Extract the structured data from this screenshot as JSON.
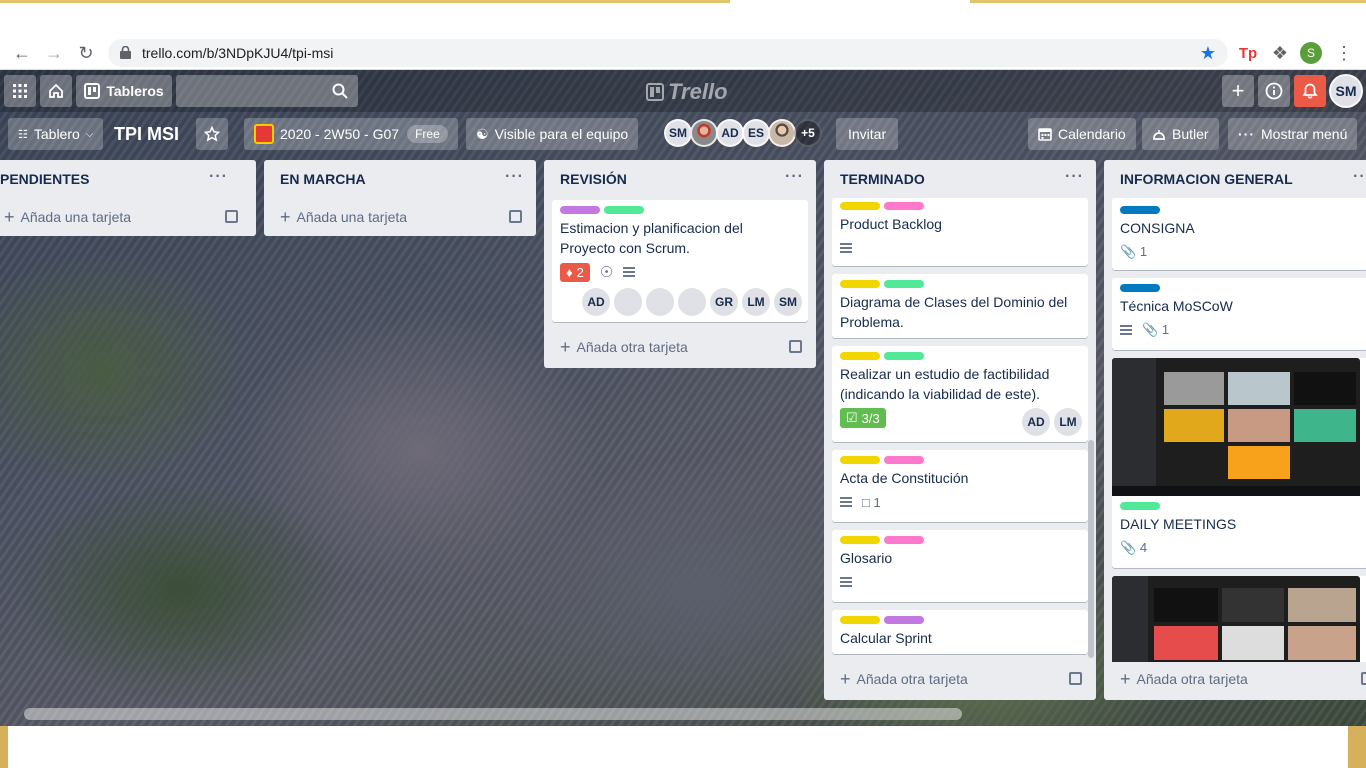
{
  "browser": {
    "url": "trello.com/b/3NDpKJU4/tpi-msi",
    "profile_initial": "S"
  },
  "header": {
    "boards_label": "Tableros",
    "logo_text": "Trello",
    "user_initials": "SM"
  },
  "boardbar": {
    "view_label": "Tablero",
    "board_name": "TPI MSI",
    "team_name": "2020 - 2W50 - G07",
    "team_plan": "Free",
    "visibility_label": "Visible para el equipo",
    "members": [
      "SM",
      "AD",
      "ES"
    ],
    "more_members": "+5",
    "invite_label": "Invitar",
    "calendar_label": "Calendario",
    "butler_label": "Butler",
    "menu_label": "Mostrar menú"
  },
  "lists": [
    {
      "title": "PENDIENTES",
      "add_label": "Añada una tarjeta"
    },
    {
      "title": "EN MARCHA",
      "add_label": "Añada una tarjeta"
    },
    {
      "title": "REVISIÓN",
      "add_label": "Añada otra tarjeta",
      "cards": [
        {
          "title": "Estimacion y planificacion del Proyecto con Scrum.",
          "notifications": "2",
          "members": [
            "AD",
            "GR",
            "LM",
            "SM"
          ]
        }
      ]
    },
    {
      "title": "TERMINADO",
      "add_label": "Añada otra tarjeta",
      "cards": [
        {
          "title": "Product Backlog"
        },
        {
          "title": "Diagrama de Clases del Dominio del Problema."
        },
        {
          "title": "Realizar un estudio de factibilidad (indicando la viabilidad de este).",
          "checklist": "3/3",
          "members": [
            "AD",
            "LM"
          ]
        },
        {
          "title": "Acta de Constitución",
          "comments": "1"
        },
        {
          "title": "Glosario"
        },
        {
          "title": "Calcular Sprint"
        }
      ]
    },
    {
      "title": "INFORMACION GENERAL",
      "add_label": "Añada otra tarjeta",
      "cards": [
        {
          "title": "CONSIGNA",
          "attachments": "1"
        },
        {
          "title": "Técnica MoSCoW",
          "attachments": "1"
        },
        {
          "title": "DAILY MEETINGS",
          "attachments": "4"
        }
      ]
    }
  ],
  "colors": {
    "label_green": "#61bd4f",
    "label_mint": "#51e898",
    "label_yellow": "#f2d600",
    "label_pink": "#ff78cb",
    "label_purple": "#c377e0",
    "label_blue": "#0079bf",
    "notification_red": "#eb5a46",
    "checklist_green": "#61bd4f"
  }
}
